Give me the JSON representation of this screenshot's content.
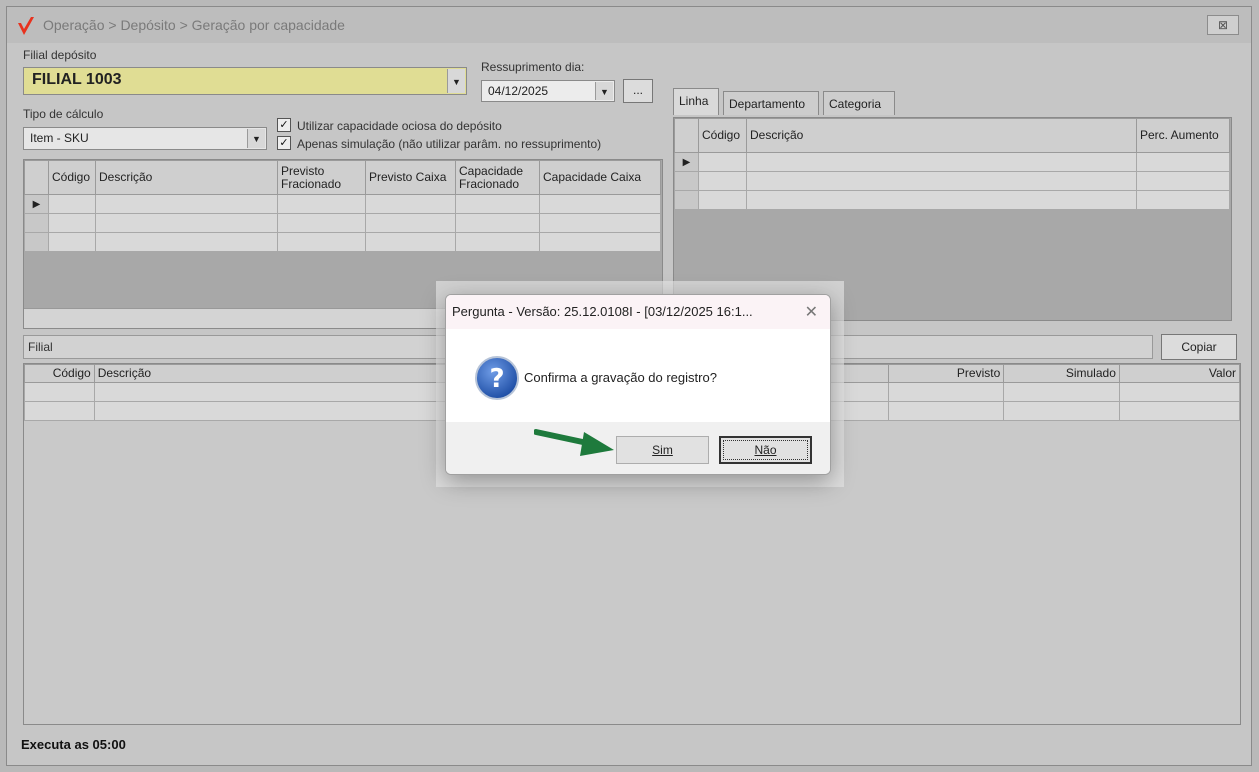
{
  "window": {
    "title": "Operação > Depósito > Geração por capacidade",
    "close_glyph": "⊠",
    "logo_color": "#e8321e"
  },
  "form": {
    "filial_label": "Filial depósito",
    "filial_value": "FILIAL 1003",
    "ressuprimento_label": "Ressuprimento dia:",
    "ressuprimento_value": "04/12/2025",
    "ellipsis_button": "...",
    "tipo_label": "Tipo de cálculo",
    "tipo_value": "Item - SKU",
    "check_ociosa": "Utilizar capacidade ociosa do depósito",
    "check_simulacao": "Apenas simulação (não utilizar parâm. no ressuprimento)",
    "filial_bar_label": "Filial",
    "copiar_button": "Copiar"
  },
  "grid_capacidade": {
    "headers": [
      "Código",
      "Descrição",
      "Previsto Fracionado",
      "Previsto Caixa",
      "Capacidade Fracionado",
      "Capacidade Caixa"
    ]
  },
  "tabs": [
    {
      "label": "Linha"
    },
    {
      "label": "Departamento"
    },
    {
      "label": "Categoria"
    }
  ],
  "grid_linha": {
    "headers": [
      "Código",
      "Descrição",
      "Perc. Aumento"
    ]
  },
  "grid_filial": {
    "headers": [
      "Código",
      "Descrição",
      "Previsto",
      "Simulado",
      "Valor"
    ]
  },
  "status": {
    "text": "Executa as 05:00"
  },
  "dialog": {
    "title": "Pergunta - Versão: 25.12.0108I - [03/12/2025 16:1...",
    "close_glyph": "✕",
    "message": "Confirma a gravação do registro?",
    "yes_button": "Sim",
    "no_button": "Não",
    "icon_color": "#1f4fa6",
    "pointer_color": "#1e7a3c"
  }
}
